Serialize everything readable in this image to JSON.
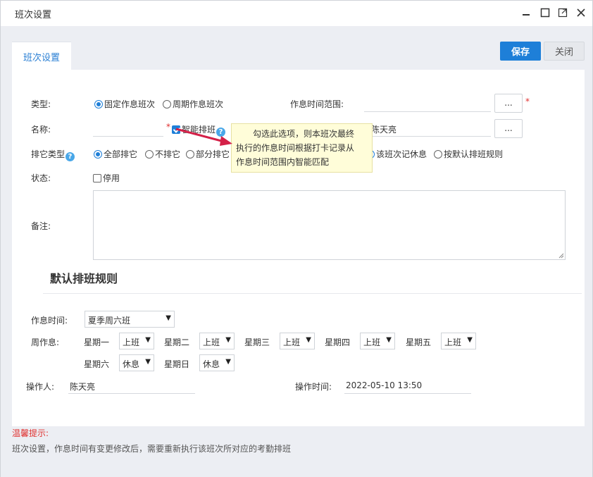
{
  "window": {
    "title": "班次设置"
  },
  "tab": {
    "label": "班次设置"
  },
  "toolbar": {
    "save_label": "保存",
    "close_label": "关闭"
  },
  "form": {
    "type_label": "类型:",
    "type_options": [
      "固定作息班次",
      "周期作息班次"
    ],
    "worktime_range_label": "作息时间范围:",
    "name_label": "名称:",
    "smart_schedule_label": "智能排班",
    "person_value": "陈天亮",
    "dots": "...",
    "required_mark": "*",
    "schedule_type_label": "排它类型",
    "schedule_type_options": [
      "全部排它",
      "不排它",
      "部分排它"
    ],
    "rest_options": [
      "该班次记休息",
      "按默认排班规则"
    ],
    "status_label": "状态:",
    "disabled_label": "停用",
    "remark_label": "备注:"
  },
  "tooltip": {
    "line1": "勾选此选项，则本班次最终",
    "line2": "执行的作息时间根据打卡记录从",
    "line3": "作息时间范围内智能匹配"
  },
  "default_rule": {
    "title": "默认排班规则",
    "worktime_label": "作息时间:",
    "worktime_value": "夏季周六班",
    "week_label": "周作息:",
    "days": [
      {
        "label": "星期一",
        "value": "上班"
      },
      {
        "label": "星期二",
        "value": "上班"
      },
      {
        "label": "星期三",
        "value": "上班"
      },
      {
        "label": "星期四",
        "value": "上班"
      },
      {
        "label": "星期五",
        "value": "上班"
      },
      {
        "label": "星期六",
        "value": "休息"
      },
      {
        "label": "星期日",
        "value": "休息"
      }
    ]
  },
  "audit": {
    "operator_label": "操作人:",
    "operator_value": "陈天亮",
    "time_label": "操作时间:",
    "time_value": "2022-05-10 13:50"
  },
  "hint": {
    "title": "温馨提示:",
    "text": "班次设置，作息时间有变更修改后，需要重新执行该班次所对应的考勤排班"
  },
  "colors": {
    "accent": "#1e7fd8",
    "warning": "#e0302f",
    "tooltip_bg": "#fffdd9"
  }
}
